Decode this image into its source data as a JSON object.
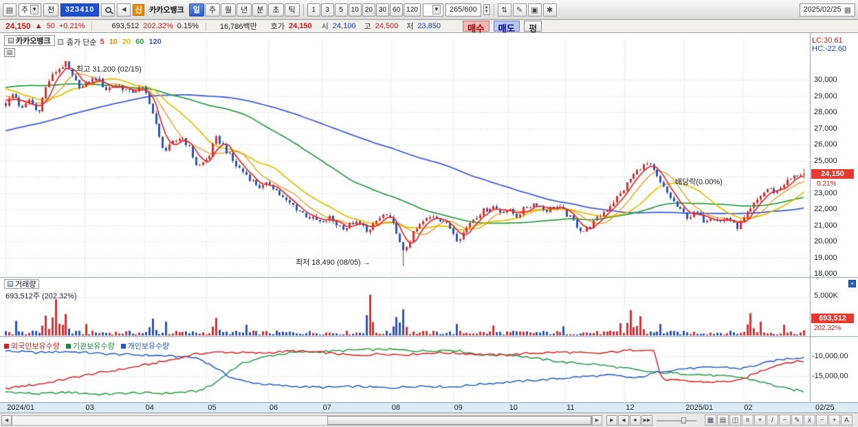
{
  "toolbar": {
    "left_icon": "▤",
    "period_select": "주",
    "prev_label": "전",
    "code_value": "323410",
    "new_badge": "신",
    "stock_name": "카카오뱅크",
    "period_tabs": [
      [
        "일",
        true
      ],
      [
        "주",
        false
      ],
      [
        "월",
        false
      ],
      [
        "년",
        false
      ],
      [
        "분",
        false
      ],
      [
        "초",
        false
      ],
      [
        "틱",
        false
      ]
    ],
    "interval_buttons": [
      "1",
      "3",
      "5",
      "10",
      "20",
      "30",
      "60",
      "120"
    ],
    "bar_count": "265/600",
    "date_value": "2025/02/25",
    "mid_icons": [
      [
        "compare-icon",
        "⇅"
      ],
      [
        "draw-icon",
        "✎"
      ],
      [
        "save-icon",
        "▣"
      ],
      [
        "settings-icon",
        "✱"
      ]
    ]
  },
  "quote": {
    "price": "24,150",
    "arrow": "▲",
    "change": "50",
    "change_pct": "+0.21%",
    "volume": "693,512",
    "volume_ratio": "202.32%",
    "turnover": "0.15%",
    "value": "16,786백만",
    "hoga_label": "호가",
    "hoga": "24,150",
    "open_label": "시",
    "open": "24,100",
    "high_label": "고",
    "high": "24,500",
    "low_label": "저",
    "low": "23,850",
    "buy_button": "매수",
    "sell_button": "매도",
    "avg_button": "평"
  },
  "chart": {
    "stock_tab": "카카오뱅크",
    "pane_icon": "▤",
    "legend_title": "종가 단순",
    "ma_legend": [
      [
        "5",
        "#e03131"
      ],
      [
        "10",
        "#f08c00"
      ],
      [
        "20",
        "#e3c000"
      ],
      [
        "60",
        "#2f9e44"
      ],
      [
        "120",
        "#3b5bdb"
      ]
    ],
    "lc": "LC:30.61",
    "hc": "HC:-22.60",
    "high_annotation": "←최고 31,200 (02/15)",
    "low_annotation": "최저 18,490 (08/05) →",
    "div_annotation": "배당락(0.00%)",
    "price_ticks": [
      [
        "30,000",
        30000
      ],
      [
        "29,000",
        29000
      ],
      [
        "28,000",
        28000
      ],
      [
        "27,000",
        27000
      ],
      [
        "26,000",
        26000
      ],
      [
        "25,000",
        25000
      ],
      [
        "23,000",
        23000
      ],
      [
        "22,000",
        22000
      ],
      [
        "21,000",
        21000
      ],
      [
        "20,000",
        20000
      ],
      [
        "19,000",
        19000
      ],
      [
        "18,000",
        18000
      ]
    ],
    "current_price": "24,150",
    "current_pct": "0.21%",
    "volume_title": "거래량",
    "volume_sub": "693,512주 (202.32%)",
    "volume_axis": "5,000K",
    "volume_badge": "693,512",
    "volume_badge_pct": "202.32%",
    "own_axis_top": "-10,000,00",
    "own_axis_bottom": "-15,000,00",
    "end_date": "02/25"
  },
  "bottom": {
    "nav_buttons": [
      [
        "play-button",
        "▶"
      ],
      [
        "back-button",
        "◀"
      ],
      [
        "stop-button",
        "■"
      ],
      [
        "end-button",
        "▶▶"
      ]
    ],
    "tools": [
      [
        "grid-tool-icon",
        "▦"
      ],
      [
        "layout-tool-icon",
        "▤"
      ],
      [
        "compare-tool-icon",
        "◫"
      ],
      [
        "indicator-tool-icon",
        "≡"
      ],
      [
        "crosshair-tool-icon",
        "+"
      ],
      [
        "trendline-tool-icon",
        "/"
      ],
      [
        "curve-tool-icon",
        "~"
      ],
      [
        "draw-tool-icon",
        "✎"
      ],
      [
        "erase-tool-icon",
        "x"
      ],
      [
        "zoom-out-icon",
        "−"
      ],
      [
        "zoom-in-icon",
        "+"
      ],
      [
        "auto-scale-icon",
        "A"
      ]
    ]
  },
  "chart_data": {
    "type": "candlestick",
    "title": "카카오뱅크 (323410) 일봉",
    "panes": [
      "price+ma(5,10,20,60,120)",
      "volume",
      "ownership-lines"
    ],
    "price_axis_range": [
      17900,
      32400
    ],
    "highest": {
      "price": 31200,
      "date": "02/15"
    },
    "lowest": {
      "price": 18490,
      "date": "08/05"
    },
    "last": {
      "open": 24100,
      "high": 24500,
      "low": 23850,
      "close": 24150,
      "change": 50,
      "change_pct": 0.21,
      "volume": 693512,
      "volume_ratio_pct": 202.32
    },
    "candle_count": 240,
    "jitter": 170,
    "wick": 150,
    "up_color": "#d93030",
    "down_color": "#2b52bd",
    "ma_colors": {
      "5": "#e03131",
      "10": "#f08c00",
      "20": "#e3c000",
      "60": "#2f9e44",
      "120": "#3b5bdb"
    },
    "close_anchors": [
      [
        0,
        28500
      ],
      [
        0.01,
        29200
      ],
      [
        0.02,
        28100
      ],
      [
        0.03,
        28800
      ],
      [
        0.04,
        27900
      ],
      [
        0.052,
        29800
      ],
      [
        0.064,
        30600
      ],
      [
        0.075,
        31000
      ],
      [
        0.085,
        30000
      ],
      [
        0.095,
        29500
      ],
      [
        0.104,
        29900
      ],
      [
        0.115,
        30100
      ],
      [
        0.125,
        29400
      ],
      [
        0.14,
        29700
      ],
      [
        0.155,
        29200
      ],
      [
        0.17,
        29500
      ],
      [
        0.178,
        29000
      ],
      [
        0.186,
        27600
      ],
      [
        0.193,
        26300
      ],
      [
        0.2,
        25600
      ],
      [
        0.21,
        26100
      ],
      [
        0.22,
        26500
      ],
      [
        0.23,
        25800
      ],
      [
        0.24,
        24600
      ],
      [
        0.248,
        24900
      ],
      [
        0.255,
        25300
      ],
      [
        0.263,
        26400
      ],
      [
        0.27,
        26100
      ],
      [
        0.28,
        25300
      ],
      [
        0.29,
        24600
      ],
      [
        0.3,
        24200
      ],
      [
        0.31,
        23700
      ],
      [
        0.32,
        23300
      ],
      [
        0.331,
        23600
      ],
      [
        0.34,
        23100
      ],
      [
        0.35,
        22500
      ],
      [
        0.36,
        22200
      ],
      [
        0.37,
        21800
      ],
      [
        0.385,
        21400
      ],
      [
        0.397,
        21100
      ],
      [
        0.405,
        21500
      ],
      [
        0.415,
        21000
      ],
      [
        0.425,
        20800
      ],
      [
        0.435,
        21200
      ],
      [
        0.445,
        21000
      ],
      [
        0.455,
        20600
      ],
      [
        0.465,
        21300
      ],
      [
        0.475,
        21700
      ],
      [
        0.482,
        21300
      ],
      [
        0.49,
        20600
      ],
      [
        0.497,
        19200
      ],
      [
        0.503,
        19800
      ],
      [
        0.512,
        20600
      ],
      [
        0.523,
        21200
      ],
      [
        0.535,
        21600
      ],
      [
        0.547,
        21300
      ],
      [
        0.559,
        20700
      ],
      [
        0.566,
        20100
      ],
      [
        0.574,
        20600
      ],
      [
        0.583,
        21300
      ],
      [
        0.595,
        21800
      ],
      [
        0.61,
        22200
      ],
      [
        0.62,
        21800
      ],
      [
        0.627,
        22000
      ],
      [
        0.64,
        21600
      ],
      [
        0.652,
        22100
      ],
      [
        0.664,
        22400
      ],
      [
        0.676,
        21900
      ],
      [
        0.688,
        22200
      ],
      [
        0.698,
        21900
      ],
      [
        0.71,
        21300
      ],
      [
        0.722,
        20600
      ],
      [
        0.734,
        21000
      ],
      [
        0.746,
        21700
      ],
      [
        0.758,
        22300
      ],
      [
        0.771,
        23000
      ],
      [
        0.783,
        23900
      ],
      [
        0.795,
        24600
      ],
      [
        0.805,
        24800
      ],
      [
        0.812,
        24300
      ],
      [
        0.82,
        23600
      ],
      [
        0.83,
        22900
      ],
      [
        0.84,
        22200
      ],
      [
        0.845,
        21900
      ],
      [
        0.855,
        21500
      ],
      [
        0.865,
        21800
      ],
      [
        0.875,
        21300
      ],
      [
        0.885,
        21600
      ],
      [
        0.895,
        21200
      ],
      [
        0.905,
        21500
      ],
      [
        0.912,
        21000
      ],
      [
        0.917,
        20900
      ],
      [
        0.925,
        21400
      ],
      [
        0.935,
        22100
      ],
      [
        0.945,
        22800
      ],
      [
        0.955,
        23300
      ],
      [
        0.965,
        23000
      ],
      [
        0.975,
        23600
      ],
      [
        0.985,
        23900
      ],
      [
        0.993,
        24200
      ],
      [
        1,
        24150
      ]
    ],
    "pre_anchors": [
      [
        0,
        22800
      ],
      [
        0.35,
        24200
      ],
      [
        0.5,
        26800
      ],
      [
        0.65,
        30000
      ],
      [
        0.8,
        30600
      ],
      [
        0.9,
        29800
      ],
      [
        1,
        28700
      ]
    ],
    "volume_axis_max_k": 5000,
    "volume_spikes_k": [
      [
        0.012,
        1900
      ],
      [
        0.052,
        2600
      ],
      [
        0.064,
        4700
      ],
      [
        0.075,
        2800
      ],
      [
        0.1,
        1500
      ],
      [
        0.186,
        2200
      ],
      [
        0.2,
        1800
      ],
      [
        0.263,
        2300
      ],
      [
        0.3,
        1400
      ],
      [
        0.455,
        5300
      ],
      [
        0.49,
        2400
      ],
      [
        0.497,
        3400
      ],
      [
        0.566,
        1500
      ],
      [
        0.61,
        1300
      ],
      [
        0.698,
        1200
      ],
      [
        0.771,
        1600
      ],
      [
        0.783,
        3300
      ],
      [
        0.795,
        2500
      ],
      [
        0.82,
        1500
      ],
      [
        0.935,
        2900
      ],
      [
        0.945,
        1800
      ],
      [
        0.975,
        1400
      ],
      [
        1,
        693
      ]
    ],
    "ownership": {
      "unit": "relative_level_0_100",
      "foreign": [
        [
          0,
          23
        ],
        [
          0.05,
          33
        ],
        [
          0.1,
          48
        ],
        [
          0.15,
          60
        ],
        [
          0.2,
          74
        ],
        [
          0.24,
          88
        ],
        [
          0.27,
          91
        ],
        [
          0.32,
          89
        ],
        [
          0.36,
          93
        ],
        [
          0.4,
          90
        ],
        [
          0.44,
          84
        ],
        [
          0.47,
          88
        ],
        [
          0.5,
          86
        ],
        [
          0.54,
          90
        ],
        [
          0.58,
          88
        ],
        [
          0.62,
          85
        ],
        [
          0.66,
          89
        ],
        [
          0.7,
          91
        ],
        [
          0.74,
          88
        ],
        [
          0.78,
          94
        ],
        [
          0.8,
          96
        ],
        [
          0.813,
          93
        ],
        [
          0.822,
          40
        ],
        [
          0.85,
          37
        ],
        [
          0.88,
          35
        ],
        [
          0.9,
          36
        ],
        [
          0.92,
          38
        ],
        [
          0.94,
          52
        ],
        [
          0.96,
          64
        ],
        [
          0.98,
          72
        ],
        [
          1,
          74
        ]
      ],
      "institution": [
        [
          0,
          17
        ],
        [
          0.04,
          13
        ],
        [
          0.08,
          16
        ],
        [
          0.12,
          12
        ],
        [
          0.16,
          15
        ],
        [
          0.2,
          14
        ],
        [
          0.24,
          18
        ],
        [
          0.26,
          30
        ],
        [
          0.28,
          55
        ],
        [
          0.3,
          72
        ],
        [
          0.33,
          84
        ],
        [
          0.36,
          90
        ],
        [
          0.4,
          92
        ],
        [
          0.44,
          95
        ],
        [
          0.48,
          96
        ],
        [
          0.52,
          93
        ],
        [
          0.56,
          95
        ],
        [
          0.58,
          90
        ],
        [
          0.6,
          85
        ],
        [
          0.63,
          87
        ],
        [
          0.66,
          80
        ],
        [
          0.7,
          72
        ],
        [
          0.74,
          68
        ],
        [
          0.78,
          60
        ],
        [
          0.8,
          55
        ],
        [
          0.83,
          52
        ],
        [
          0.86,
          50
        ],
        [
          0.89,
          47
        ],
        [
          0.92,
          44
        ],
        [
          0.94,
          38
        ],
        [
          0.96,
          30
        ],
        [
          0.98,
          22
        ],
        [
          1,
          18
        ]
      ],
      "individual": [
        [
          0,
          93
        ],
        [
          0.04,
          90
        ],
        [
          0.08,
          92
        ],
        [
          0.12,
          88
        ],
        [
          0.16,
          86
        ],
        [
          0.2,
          84
        ],
        [
          0.24,
          80
        ],
        [
          0.26,
          65
        ],
        [
          0.28,
          45
        ],
        [
          0.3,
          36
        ],
        [
          0.33,
          30
        ],
        [
          0.36,
          27
        ],
        [
          0.4,
          25
        ],
        [
          0.44,
          27
        ],
        [
          0.48,
          24
        ],
        [
          0.52,
          28
        ],
        [
          0.56,
          26
        ],
        [
          0.6,
          32
        ],
        [
          0.64,
          36
        ],
        [
          0.68,
          40
        ],
        [
          0.72,
          45
        ],
        [
          0.76,
          48
        ],
        [
          0.79,
          42
        ],
        [
          0.82,
          55
        ],
        [
          0.85,
          60
        ],
        [
          0.88,
          62
        ],
        [
          0.9,
          63
        ],
        [
          0.92,
          60
        ],
        [
          0.94,
          66
        ],
        [
          0.96,
          74
        ],
        [
          0.98,
          79
        ],
        [
          1,
          81
        ]
      ],
      "colors": {
        "foreign": "#d62c2c",
        "institution": "#2e9e4f",
        "individual": "#2f62c4"
      },
      "legend": [
        [
          "외국인보유수량",
          "#cc2222"
        ],
        [
          "기관보유수량",
          "#1f8a3c"
        ],
        [
          "개인보유수량",
          "#2255cc"
        ]
      ]
    },
    "months": [
      [
        "2024/01",
        0.007
      ],
      [
        "03",
        0.104
      ],
      [
        "04",
        0.178
      ],
      [
        "05",
        0.255
      ],
      [
        "06",
        0.331
      ],
      [
        "07",
        0.397
      ],
      [
        "08",
        0.482
      ],
      [
        "09",
        0.559
      ],
      [
        "10",
        0.627
      ],
      [
        "11",
        0.698
      ],
      [
        "12",
        0.771
      ],
      [
        "2025/01",
        0.845
      ],
      [
        "02",
        0.917
      ]
    ]
  }
}
